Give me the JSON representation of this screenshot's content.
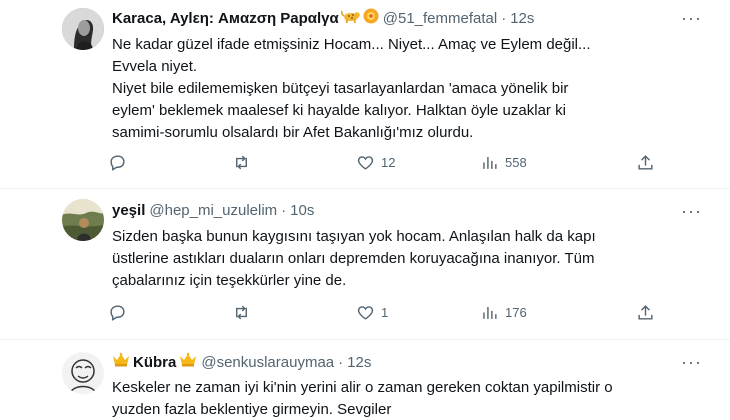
{
  "tweets": [
    {
      "name": "Karaca, Aylεη: Aмαzση Papαlγα",
      "handle": "@51_femmefatal",
      "time": "12s",
      "lines": [
        "Ne kadar güzel ifade etmişsiniz Hocam... Niyet... Amaç ve Eylem değil...",
        "Evvela niyet.",
        "Niyet bile edilememişken bütçeyi tasarlayanlardan 'amaca yönelik bir",
        "eylem' beklemek maalesef ki hayalde kalıyor. Halktan öyle uzaklar ki",
        "samimi-sorumlu olsalardı bir Afet Bakanlığı'mız olurdu."
      ],
      "stats": {
        "replies": "",
        "retweets": "",
        "likes": "12",
        "views": "558"
      },
      "icons": {
        "name_emoji": [
          "leopard-emoji",
          "sun-emoji"
        ]
      }
    },
    {
      "name": "yeşil",
      "handle": "@hep_mi_uzulelim",
      "time": "10s",
      "lines": [
        "Sizden başka bunun kaygısını taşıyan yok hocam. Anlaşılan halk da kapı",
        "üstlerine astıkları duaların onları depremden koruyacağına inanıyor. Tüm",
        "çabalarınız için teşekkürler yine de."
      ],
      "stats": {
        "replies": "",
        "retweets": "",
        "likes": "1",
        "views": "176"
      }
    },
    {
      "name": "Kübra",
      "handle": "@senkuslarauymaa",
      "time": "12s",
      "lines": [
        "Keskeler ne zaman iyi ki'nin yerini alir o zaman gereken coktan yapilmistir o",
        "yuzden fazla beklentiye girmeyin. Sevgiler"
      ],
      "icons": {
        "name_emoji": [
          "crown-emoji",
          "crown-emoji"
        ]
      }
    }
  ],
  "ui": {
    "separator": "·",
    "more": "···"
  },
  "colors": {
    "text": "#0f1419",
    "muted": "#536471",
    "divider": "#eff3f4"
  }
}
